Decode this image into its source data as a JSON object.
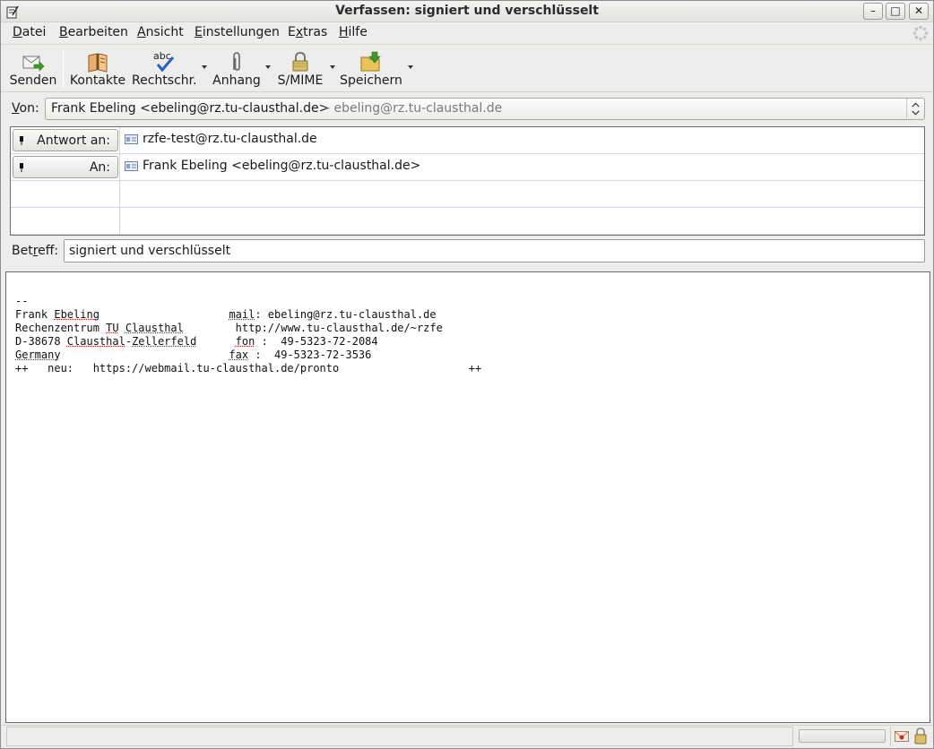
{
  "window": {
    "title": "Verfassen: signiert und verschlüsselt",
    "controls": {
      "minimize": "–",
      "maximize": "□",
      "close": "✕"
    }
  },
  "menubar": [
    {
      "label": "Datei",
      "accel": "D",
      "rest": "atei"
    },
    {
      "label": "Bearbeiten",
      "accel": "B",
      "rest": "earbeiten"
    },
    {
      "label": "Ansicht",
      "accel": "A",
      "rest": "nsicht"
    },
    {
      "label": "Einstellungen",
      "accel": "E",
      "rest": "instellungen"
    },
    {
      "label": "Extras",
      "pre": "E",
      "accel": "x",
      "rest": "tras"
    },
    {
      "label": "Hilfe",
      "accel": "H",
      "rest": "ilfe"
    }
  ],
  "toolbar": {
    "send": "Senden",
    "contacts": "Kontakte",
    "spell": "Rechtschr.",
    "spell_icon_text": "abc",
    "attach": "Anhang",
    "smime": "S/MIME",
    "save": "Speichern"
  },
  "from": {
    "label_accel": "V",
    "label_rest": "on:",
    "name": "Frank Ebeling <ebeling@rz.tu-clausthal.de>",
    "account": "- ebeling@rz.tu-clausthal.de"
  },
  "addressing": [
    {
      "type": "Antwort an:",
      "value": "rzfe-test@rz.tu-clausthal.de"
    },
    {
      "type": "An:",
      "value": "Frank Ebeling <ebeling@rz.tu-clausthal.de>"
    }
  ],
  "subject": {
    "label_pre": "Bet",
    "label_accel": "r",
    "label_rest": "eff:",
    "value": "signiert und verschlüsselt"
  },
  "body": {
    "separator": "--",
    "lines": [
      {
        "left_a": "Frank ",
        "left_sp": "Ebeling",
        "left_b": "",
        "gap": "                    ",
        "right_sp": "mail",
        "right_b": ": ebeling@rz.tu-clausthal.de"
      },
      {
        "left_a": "Rechenzentrum ",
        "left_sp": "TU",
        "left_b": " ",
        "left_sp2": "Clausthal",
        "gap": "        ",
        "right_sp": "",
        "right_b": "http://www.tu-clausthal.de/~rzfe"
      },
      {
        "left_a": "D-38678 ",
        "left_sp": "Clausthal",
        "left_b": "-",
        "left_sp2": "Zellerfeld",
        "gap": "      ",
        "right_sp": "fon",
        "right_b": " :  49-5323-72-2084"
      },
      {
        "left_a": "",
        "left_sp": "Germany",
        "left_b": "",
        "gap": "                          ",
        "right_sp": "fax",
        "right_b": " :  49-5323-72-3536"
      }
    ],
    "last_line": "++   neu:   https://webmail.tu-clausthal.de/pronto                    ++"
  }
}
